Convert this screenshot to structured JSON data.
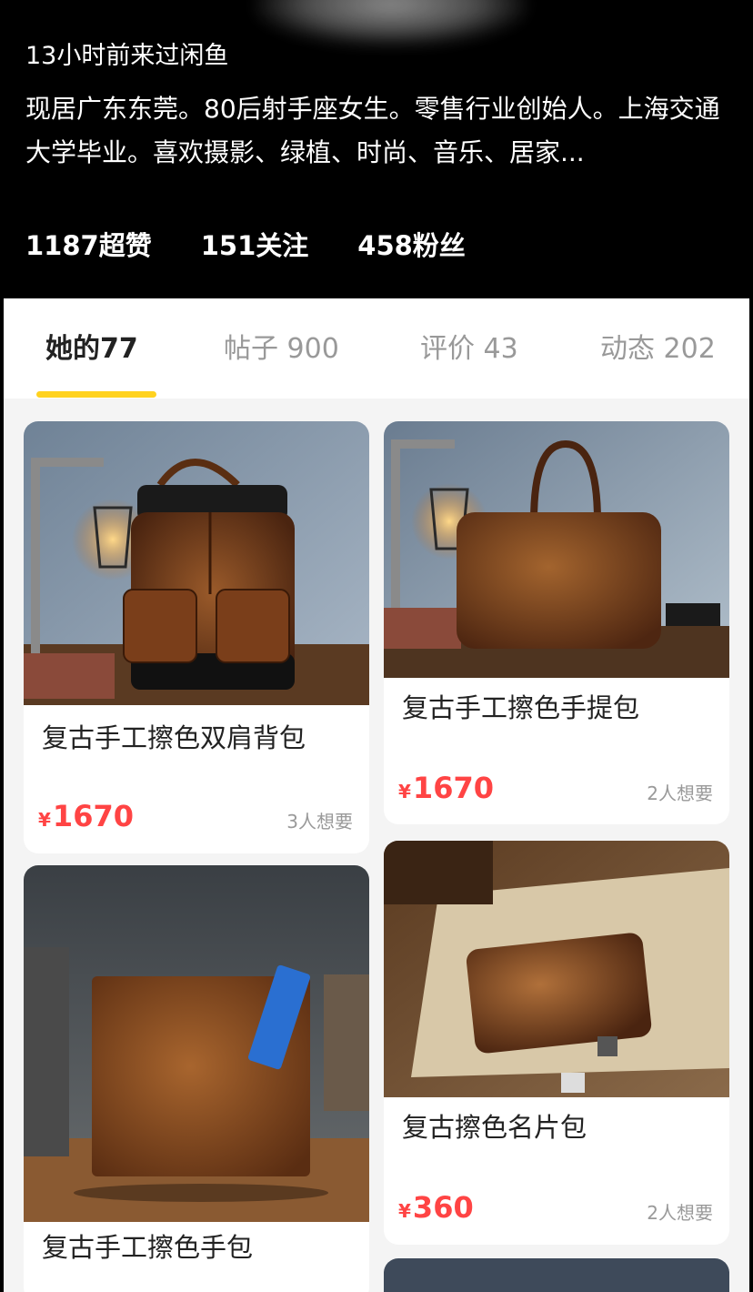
{
  "header": {
    "last_seen": "13小时前来过闲鱼",
    "bio": "现居广东东莞。80后射手座女生。零售行业创始人。上海交通大学毕业。喜欢摄影、绿植、时尚、音乐、居家...",
    "stats": {
      "likes": "1187超赞",
      "following": "151关注",
      "followers": "458粉丝"
    }
  },
  "tabs": [
    {
      "label": "她的77",
      "active": true
    },
    {
      "label": "帖子 900",
      "active": false
    },
    {
      "label": "评价 43",
      "active": false
    },
    {
      "label": "动态 202",
      "active": false
    }
  ],
  "accent_color": "#ffd21f",
  "price_color": "#ff4444",
  "items": [
    {
      "title": "复古手工擦色双肩背包",
      "currency": "¥",
      "price": "1670",
      "wants": "3人想要",
      "image_icon": "leather-backpack-photo"
    },
    {
      "title": "复古手工擦色手提包",
      "currency": "¥",
      "price": "1670",
      "wants": "2人想要",
      "image_icon": "leather-briefcase-photo"
    },
    {
      "title": "复古手工擦色手包",
      "image_icon": "leather-clutch-photo"
    },
    {
      "title": "复古擦色名片包",
      "currency": "¥",
      "price": "360",
      "wants": "2人想要",
      "image_icon": "leather-card-holder-photo"
    },
    {
      "image_icon": "partial-item-photo"
    }
  ]
}
